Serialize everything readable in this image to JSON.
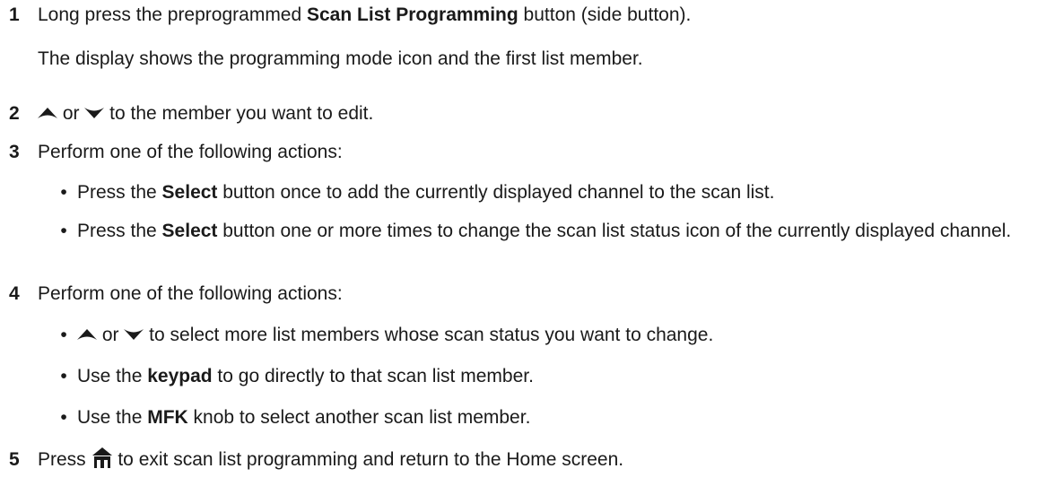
{
  "steps": [
    {
      "num": "1",
      "pre": "Long press the preprogrammed ",
      "bold": "Scan List Programming",
      "post": " button (side button).",
      "note": "The display shows the programming mode icon and the first list member."
    },
    {
      "num": "2",
      "or": " or ",
      "post": " to the member you want to edit."
    },
    {
      "num": "3",
      "text": "Perform one of the following actions:",
      "bullets": [
        {
          "pre": "Press the ",
          "bold": "Select",
          "post": " button once to add the currently displayed channel to the scan list."
        },
        {
          "pre": "Press the ",
          "bold": "Select",
          "post": " button one or more times to change the scan list status icon of the currently displayed channel."
        }
      ]
    },
    {
      "num": "4",
      "text": "Perform one of the following actions:",
      "bullets": [
        {
          "or": " or ",
          "post": " to select more list members whose scan status you want to change."
        },
        {
          "pre": "Use the ",
          "bold": "keypad",
          "post": " to go directly to that scan list member."
        },
        {
          "pre": "Use the ",
          "bold": "MFK",
          "post": " knob to select another scan list member."
        }
      ]
    },
    {
      "num": "5",
      "pre": "Press ",
      "post": " to exit scan list programming and return to the Home screen."
    }
  ],
  "bullet_glyph": "•",
  "icons": {
    "up": "up-arrow-icon",
    "down": "down-arrow-icon",
    "home": "home-icon"
  }
}
